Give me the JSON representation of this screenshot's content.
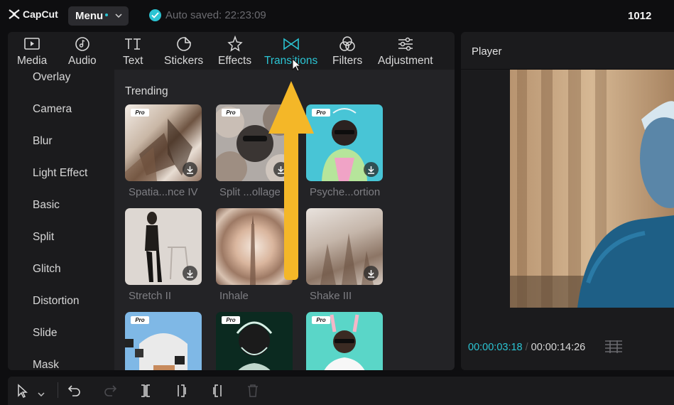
{
  "app": {
    "logo": "CapCut",
    "menu_label": "Menu",
    "autosave": "Auto saved: 22:23:09",
    "project_title": "1012"
  },
  "tabs": [
    {
      "label": "Media",
      "icon": "media-icon"
    },
    {
      "label": "Audio",
      "icon": "audio-icon"
    },
    {
      "label": "Text",
      "icon": "text-icon"
    },
    {
      "label": "Stickers",
      "icon": "stickers-icon"
    },
    {
      "label": "Effects",
      "icon": "effects-icon"
    },
    {
      "label": "Transitions",
      "icon": "transitions-icon",
      "active": true
    },
    {
      "label": "Filters",
      "icon": "filters-icon"
    },
    {
      "label": "Adjustment",
      "icon": "adjustment-icon"
    }
  ],
  "sidebar": [
    "Overlay",
    "Camera",
    "Blur",
    "Light Effect",
    "Basic",
    "Split",
    "Glitch",
    "Distortion",
    "Slide",
    "Mask"
  ],
  "content": {
    "section_title": "Trending",
    "pro_badge": "Pro",
    "cards": [
      {
        "label": "Spatia...nce IV",
        "pro": true
      },
      {
        "label": "Split ...ollage",
        "pro": true
      },
      {
        "label": "Psyche...ortion",
        "pro": true
      },
      {
        "label": "Stretch II",
        "pro": false
      },
      {
        "label": "Inhale",
        "pro": false
      },
      {
        "label": "Shake III",
        "pro": false
      },
      {
        "label": "",
        "pro": true
      },
      {
        "label": "",
        "pro": true
      },
      {
        "label": "",
        "pro": true
      }
    ]
  },
  "player": {
    "title": "Player",
    "current_time": "00:00:03:18",
    "separator": "/",
    "total_time": "00:00:14:26"
  },
  "colors": {
    "accent": "#2bc4d3",
    "annotation_arrow": "#f4b728"
  }
}
